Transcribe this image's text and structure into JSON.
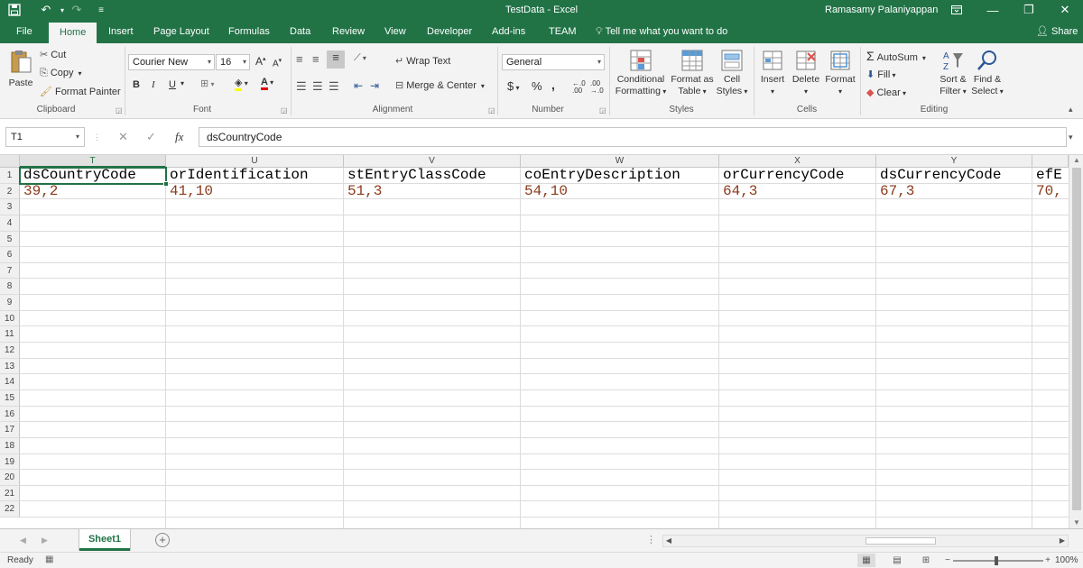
{
  "window": {
    "title": "TestData  -  Excel",
    "user": "Ramasamy Palaniyappan",
    "accent_color": "#217346"
  },
  "quick_access": [
    "save-icon",
    "undo-icon",
    "redo-icon",
    "customize-icon"
  ],
  "tabs": [
    "File",
    "Home",
    "Insert",
    "Page Layout",
    "Formulas",
    "Data",
    "Review",
    "View",
    "Developer",
    "Add-ins",
    "TEAM"
  ],
  "active_tab": "Home",
  "tell_me": "Tell me what you want to do",
  "share": "Share",
  "ribbon": {
    "clipboard": {
      "label": "Clipboard",
      "paste": "Paste",
      "cut": "Cut",
      "copy": "Copy",
      "format_painter": "Format Painter"
    },
    "font": {
      "label": "Font",
      "font_name": "Courier New",
      "font_size": "16",
      "bold": "B",
      "italic": "I",
      "underline": "U"
    },
    "alignment": {
      "label": "Alignment",
      "wrap_text": "Wrap Text",
      "merge_center": "Merge & Center"
    },
    "number": {
      "label": "Number",
      "format": "General",
      "currency": "$",
      "percent": "%",
      "comma": ","
    },
    "styles": {
      "label": "Styles",
      "conditional_1": "Conditional",
      "conditional_2": "Formatting",
      "format_table_1": "Format as",
      "format_table_2": "Table",
      "cell_styles_1": "Cell",
      "cell_styles_2": "Styles"
    },
    "cells": {
      "label": "Cells",
      "insert": "Insert",
      "delete": "Delete",
      "format": "Format"
    },
    "editing": {
      "label": "Editing",
      "autosum": "AutoSum",
      "fill": "Fill",
      "clear": "Clear",
      "sort_1": "Sort &",
      "sort_2": "Filter",
      "find_1": "Find &",
      "find_2": "Select"
    }
  },
  "formula_bar": {
    "name_box": "T1",
    "cancel": "✕",
    "enter": "✓",
    "fx": "fx",
    "content": "dsCountryCode"
  },
  "sheet": {
    "columns": [
      "T",
      "U",
      "V",
      "W",
      "X",
      "Y",
      ""
    ],
    "rows": [
      "1",
      "2",
      "3",
      "4",
      "5",
      "6",
      "7",
      "8",
      "9",
      "10",
      "11",
      "12",
      "13",
      "14",
      "15",
      "16",
      "17",
      "18",
      "19",
      "20",
      "21",
      "22"
    ],
    "row1": [
      "dsCountryCode",
      "orIdentification",
      "stEntryClassCode",
      "coEntryDescription",
      "orCurrencyCode",
      "dsCurrencyCode",
      "efE"
    ],
    "row2": [
      "39,2",
      "41,10",
      "51,3",
      "54,10",
      "64,3",
      "67,3",
      "70,"
    ]
  },
  "sheet_tabs": {
    "active": "Sheet1"
  },
  "status": {
    "ready": "Ready",
    "zoom": "100%"
  }
}
